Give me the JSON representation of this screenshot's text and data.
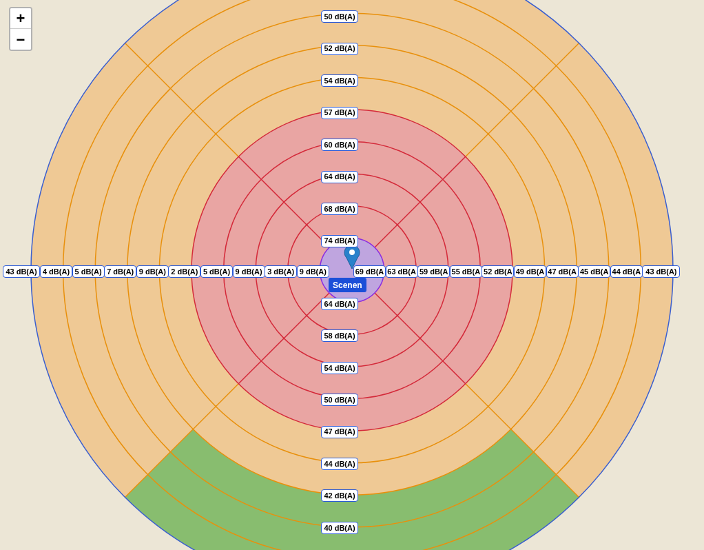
{
  "zoom_control": {
    "zoom_in": "+",
    "zoom_out": "−"
  },
  "labels_north": [
    "50 dB(A)",
    "52 dB(A)",
    "54 dB(A)",
    "57 dB(A)",
    "60 dB(A)",
    "64 dB(A)",
    "68 dB(A)",
    "74 dB(A)"
  ],
  "labels_south": [
    "64 dB(A)",
    "58 dB(A)",
    "54 dB(A)",
    "50 dB(A)",
    "47 dB(A)",
    "44 dB(A)",
    "42 dB(A)",
    "40 dB(A)"
  ],
  "labels_west": [
    "43 dB(A)",
    "4 dB(A)",
    "5 dB(A)",
    "7 dB(A)",
    "9 dB(A)",
    "2 dB(A)",
    "5 dB(A)",
    "9 dB(A)",
    "3 dB(A)",
    "9 dB(A)"
  ],
  "labels_east": [
    "69 dB(A",
    "63 dB(A",
    "59 dB(A",
    "55 dB(A",
    "52 dB(A",
    "49 dB(A",
    "47 dB(A",
    "45 dB(A",
    "44 dB(A",
    "43 dB(A)"
  ],
  "marker": {
    "label": "Scenen"
  }
}
